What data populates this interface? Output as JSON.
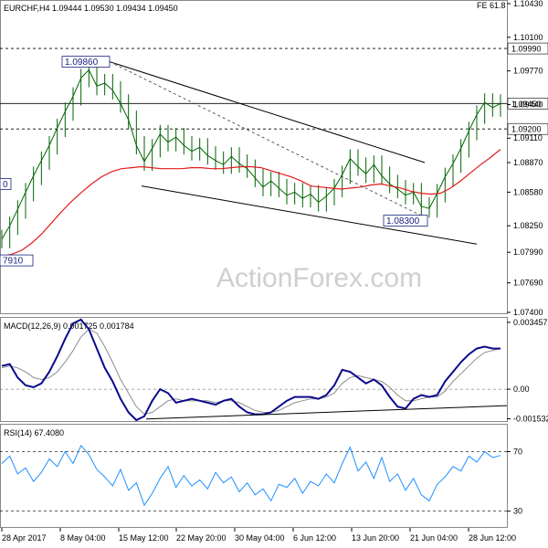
{
  "chart_data": [
    {
      "type": "line",
      "panel": "price",
      "header": "EURCHF,H4 1.09444 1.09530 1.09434 1.09450",
      "corner_label": "FE 61.8",
      "watermark": "ActionForex.com",
      "symbol": "EURCHF",
      "timeframe": "H4",
      "ohlc": [
        1.09444,
        1.0953,
        1.09434,
        1.0945
      ],
      "ylim": [
        1.074,
        1.1043
      ],
      "ytick_labels": [
        "1.10430",
        "1.10100",
        "1.09770",
        "1.09440",
        "1.09110",
        "1.08870",
        "1.08580",
        "1.08250",
        "1.07990",
        "1.07690",
        "1.07400"
      ],
      "ytick_values": [
        1.1043,
        1.101,
        1.0977,
        1.0944,
        1.0911,
        1.0887,
        1.0858,
        1.0825,
        1.0799,
        1.0769,
        1.074
      ],
      "x_categories": [
        "28 Apr 2017",
        "8 May 04:00",
        "15 May 12:00",
        "22 May 20:00",
        "30 May 04:00",
        "6 Jun 12:00",
        "13 Jun 20:00",
        "21 Jun 04:00",
        "28 Jun 12:00"
      ],
      "horizontal_levels": [
        {
          "value": 1.0999,
          "label": "1.09990",
          "style": "dashed"
        },
        {
          "value": 1.092,
          "label": "1.09200",
          "style": "dashed"
        },
        {
          "value": 1.0945,
          "label": "1.09450",
          "style": "solid"
        }
      ],
      "annotations": [
        "1.09860",
        "1.08300",
        "7910",
        "0"
      ],
      "close": [
        1.0812,
        1.0825,
        1.0841,
        1.0858,
        1.0874,
        1.0889,
        1.0904,
        1.0921,
        1.0937,
        1.0952,
        1.097,
        1.0978,
        1.0962,
        1.0965,
        1.0958,
        1.0945,
        1.0929,
        1.0904,
        1.0888,
        1.0901,
        1.0915,
        1.0907,
        1.0912,
        1.0904,
        1.0898,
        1.0902,
        1.0894,
        1.0889,
        1.0885,
        1.0893,
        1.0886,
        1.0881,
        1.0872,
        1.0863,
        1.0869,
        1.0862,
        1.0855,
        1.0858,
        1.0852,
        1.0856,
        1.0848,
        1.0854,
        1.0862,
        1.0875,
        1.0891,
        1.0883,
        1.0876,
        1.0885,
        1.0874,
        1.0866,
        1.0861,
        1.0855,
        1.0858,
        1.0844,
        1.0842,
        1.0857,
        1.0873,
        1.0886,
        1.0901,
        1.0918,
        1.0934,
        1.0946,
        1.0941,
        1.0945
      ],
      "moving_average": [
        1.0795,
        1.0797,
        1.0801,
        1.0808,
        1.0817,
        1.0828,
        1.0839,
        1.0849,
        1.0858,
        1.0866,
        1.0873,
        1.0878,
        1.0881,
        1.0882,
        1.0883,
        1.0882,
        1.0881,
        1.0881,
        1.0881,
        1.0882,
        1.0882,
        1.0881,
        1.0881,
        1.0882,
        1.0883,
        1.0883,
        1.0882,
        1.0879,
        1.0876,
        1.0873,
        1.0869,
        1.0864,
        1.0863,
        1.0862,
        1.0861,
        1.0862,
        1.0863,
        1.0865,
        1.0866,
        1.0864,
        1.0862,
        1.0859,
        1.0857,
        1.0856,
        1.0857,
        1.0862,
        1.0869,
        1.0877,
        1.0885,
        1.0892,
        1.09
      ],
      "channel_upper": [
        [
          1.0986,
          1.0887
        ]
      ],
      "channel_lower": [
        [
          1.0864,
          1.0807
        ]
      ],
      "colors": {
        "price": "#006400",
        "ma": "#e41a1c",
        "levels": "#000000",
        "label_box": "#1a237e"
      }
    },
    {
      "type": "line",
      "panel": "macd",
      "legend": "MACD(12,26,9) 0.001725 0.001784",
      "ylim": [
        -0.0016,
        0.0035
      ],
      "ytick_labels": [
        "0.003457",
        "0.00",
        "-0.001532"
      ],
      "ytick_values": [
        0.003457,
        0.0,
        -0.001532
      ],
      "macd": [
        0.0012,
        0.0013,
        0.0006,
        0.0002,
        0.0001,
        0.0003,
        0.0009,
        0.0017,
        0.0026,
        0.0034,
        0.0036,
        0.0031,
        0.0021,
        0.0011,
        0.0004,
        -0.0005,
        -0.0012,
        -0.0016,
        -0.0014,
        -0.0006,
        0.0,
        -0.0002,
        -0.0007,
        -0.0006,
        -0.0005,
        -0.0006,
        -0.0007,
        -0.0008,
        -0.0006,
        -0.0005,
        -0.0009,
        -0.0012,
        -0.0013,
        -0.0013,
        -0.0012,
        -0.0009,
        -0.0006,
        -0.0004,
        -0.0004,
        -0.0004,
        -0.0005,
        -0.0003,
        0.0002,
        0.001,
        0.0009,
        0.0006,
        0.0003,
        0.0005,
        0.0002,
        -0.0004,
        -0.0009,
        -0.001,
        -0.0005,
        -0.0003,
        -0.0004,
        -0.0003,
        0.0004,
        0.0009,
        0.0014,
        0.0018,
        0.0021,
        0.0022,
        0.0021,
        0.0021
      ],
      "signal": [
        0.0011,
        0.0012,
        0.0011,
        0.0009,
        0.0006,
        0.0005,
        0.0006,
        0.0009,
        0.0014,
        0.002,
        0.0027,
        0.0031,
        0.0029,
        0.0022,
        0.0014,
        0.0005,
        -0.0002,
        -0.0009,
        -0.0013,
        -0.0012,
        -0.0009,
        -0.0006,
        -0.0005,
        -0.0006,
        -0.0006,
        -0.0006,
        -0.0006,
        -0.0007,
        -0.0006,
        -0.0006,
        -0.0007,
        -0.0009,
        -0.0011,
        -0.0012,
        -0.0012,
        -0.0011,
        -0.0009,
        -0.0007,
        -0.0006,
        -0.0005,
        -0.0005,
        -0.0004,
        -0.0002,
        0.0003,
        0.0006,
        0.0007,
        0.0006,
        0.0005,
        0.0004,
        0.0001,
        -0.0003,
        -0.0006,
        -0.0006,
        -0.0005,
        -0.0004,
        -0.0004,
        -0.0001,
        0.0004,
        0.0008,
        0.0012,
        0.0016,
        0.0019,
        0.002,
        0.0021
      ],
      "colors": {
        "macd": "#0a0a8c",
        "signal": "#8c8c8c",
        "trendline": "#000000",
        "zero": "#555555"
      }
    },
    {
      "type": "line",
      "panel": "rsi",
      "legend": "RSI(14) 67.4080",
      "ylim": [
        20,
        85
      ],
      "ytick_labels": [
        "70",
        "30"
      ],
      "ytick_values": [
        70,
        30
      ],
      "x_categories": [
        "28 Apr 2017",
        "8 May 04:00",
        "15 May 12:00",
        "22 May 20:00",
        "30 May 04:00",
        "6 Jun 12:00",
        "13 Jun 20:00",
        "21 Jun 04:00",
        "28 Jun 12:00"
      ],
      "values": [
        62,
        67,
        55,
        59,
        50,
        56,
        65,
        60,
        70,
        62,
        74,
        68,
        58,
        53,
        47,
        58,
        44,
        49,
        34,
        42,
        52,
        60,
        46,
        54,
        47,
        51,
        45,
        56,
        49,
        53,
        43,
        49,
        41,
        45,
        37,
        48,
        46,
        52,
        42,
        50,
        47,
        55,
        49,
        62,
        73,
        57,
        63,
        52,
        66,
        50,
        55,
        44,
        52,
        41,
        37,
        48,
        53,
        60,
        57,
        67,
        63,
        70,
        66,
        67.4
      ],
      "colors": {
        "rsi": "#1e90ff",
        "levels": "#000000"
      }
    }
  ]
}
